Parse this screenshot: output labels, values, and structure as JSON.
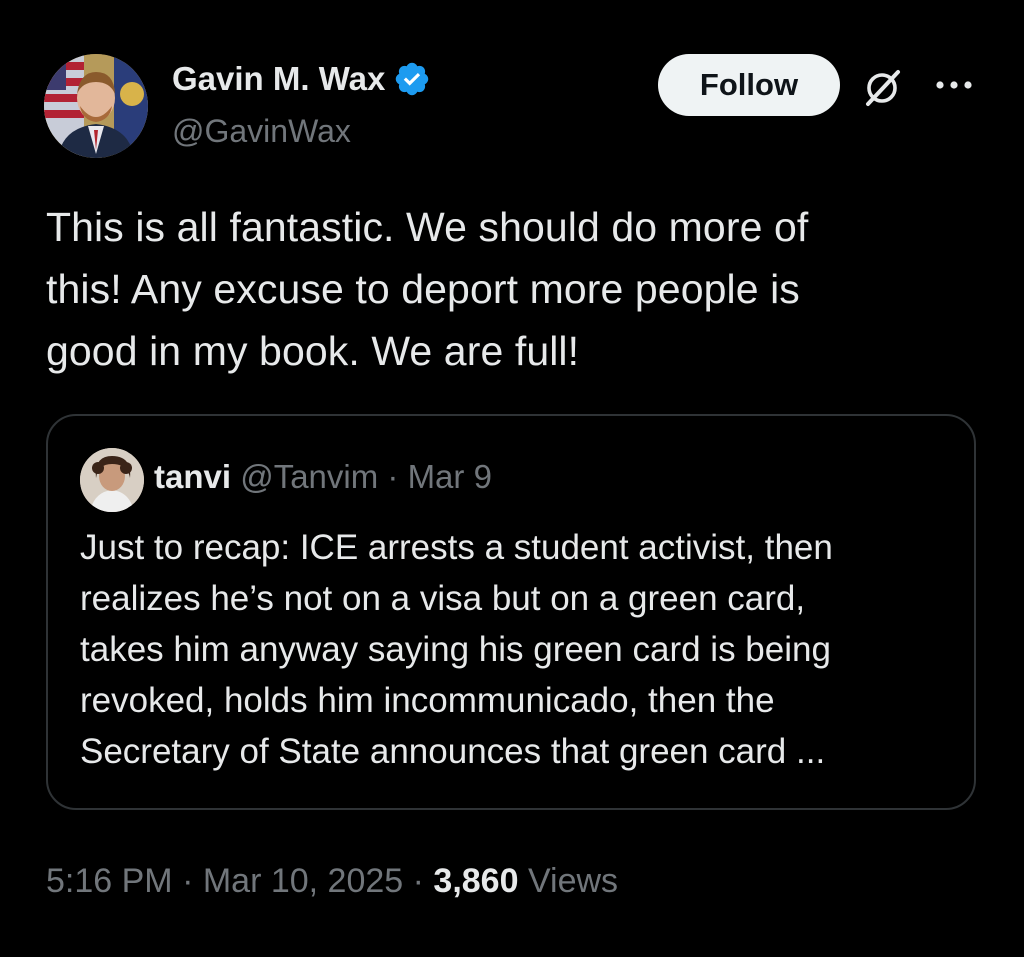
{
  "author": {
    "name": "Gavin M. Wax",
    "handle": "@GavinWax",
    "verified": true
  },
  "actions": {
    "follow_label": "Follow",
    "grok_icon": "grok-icon",
    "more_icon": "more-icon"
  },
  "tweet": {
    "text": "This is all fantastic. We should do more of\nthis! Any excuse to deport more people is\ngood in my book. We are full!"
  },
  "quote": {
    "name": "tanvi",
    "handle": "@Tanvim",
    "separator": " · ",
    "date": "Mar 9",
    "text": "Just to recap: ICE arrests a student activist, then\nrealizes he’s not on a visa but on a green card,\ntakes him anyway saying his green card is being\nrevoked, holds him incommunicado, then the\nSecretary of State announces that green card ..."
  },
  "meta": {
    "time": "5:16 PM",
    "separator": " · ",
    "date": "Mar 10, 2025",
    "views_count": "3,860",
    "views_label": "Views"
  },
  "colors": {
    "background": "#000000",
    "text_primary": "#e7e9ea",
    "text_secondary": "#71767b",
    "verified_blue": "#1d9bf0",
    "border": "#2f3336",
    "follow_bg": "#eff3f4"
  }
}
